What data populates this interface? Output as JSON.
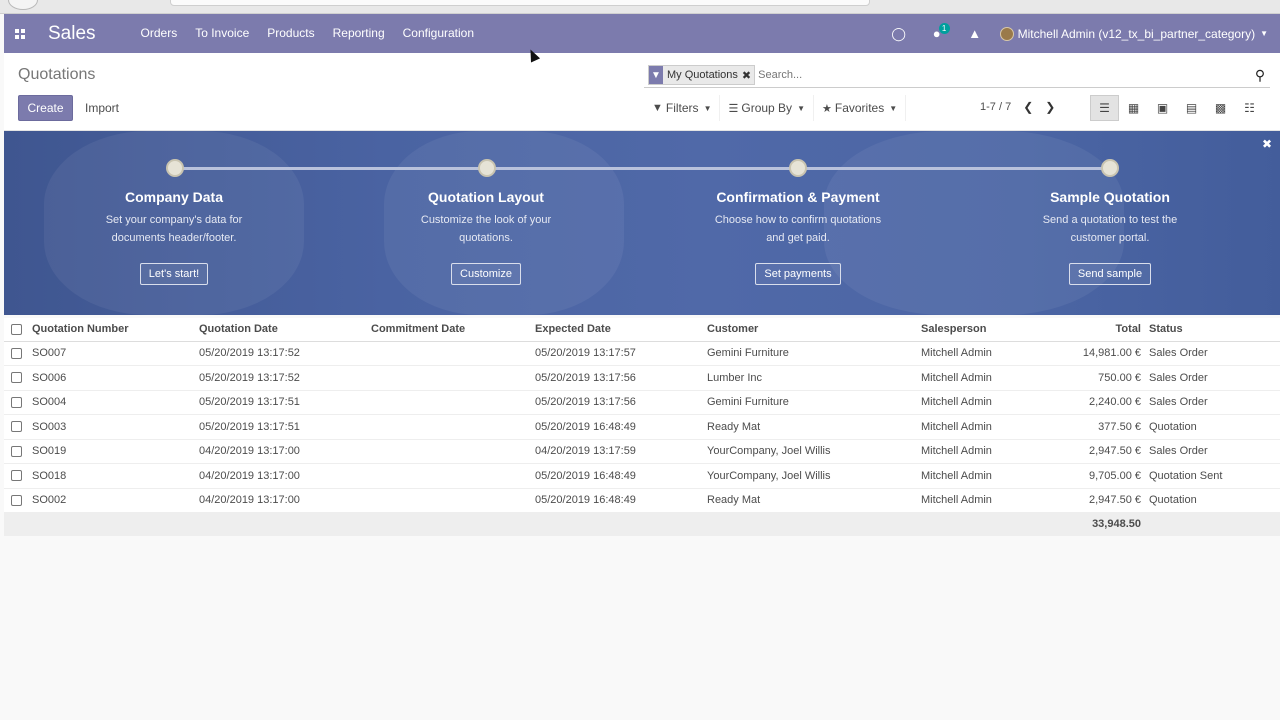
{
  "navbar": {
    "brand": "Sales",
    "menu": [
      "Orders",
      "To Invoice",
      "Products",
      "Reporting",
      "Configuration"
    ],
    "chat_count": "1",
    "user": "Mitchell Admin (v12_tx_bi_partner_category)"
  },
  "control": {
    "title": "Quotations",
    "create_label": "Create",
    "import_label": "Import",
    "facet_label": "My Quotations",
    "search_placeholder": "Search...",
    "filters_label": "Filters",
    "groupby_label": "Group By",
    "favorites_label": "Favorites",
    "pager": "1-7 / 7"
  },
  "banner": {
    "steps": [
      {
        "title": "Company Data",
        "desc1": "Set your company's data for",
        "desc2": "documents header/footer.",
        "button": "Let's start!"
      },
      {
        "title": "Quotation Layout",
        "desc1": "Customize the look of your",
        "desc2": "quotations.",
        "button": "Customize"
      },
      {
        "title": "Confirmation & Payment",
        "desc1": "Choose how to confirm quotations",
        "desc2": "and get paid.",
        "button": "Set payments"
      },
      {
        "title": "Sample Quotation",
        "desc1": "Send a quotation to test the",
        "desc2": "customer portal.",
        "button": "Send sample"
      }
    ]
  },
  "table": {
    "columns": [
      "Quotation Number",
      "Quotation Date",
      "Commitment Date",
      "Expected Date",
      "Customer",
      "Salesperson",
      "Total",
      "Status"
    ],
    "rows": [
      [
        "SO007",
        "05/20/2019 13:17:52",
        "",
        "05/20/2019 13:17:57",
        "Gemini Furniture",
        "Mitchell Admin",
        "14,981.00 €",
        "Sales Order"
      ],
      [
        "SO006",
        "05/20/2019 13:17:52",
        "",
        "05/20/2019 13:17:56",
        "Lumber Inc",
        "Mitchell Admin",
        "750.00 €",
        "Sales Order"
      ],
      [
        "SO004",
        "05/20/2019 13:17:51",
        "",
        "05/20/2019 13:17:56",
        "Gemini Furniture",
        "Mitchell Admin",
        "2,240.00 €",
        "Sales Order"
      ],
      [
        "SO003",
        "05/20/2019 13:17:51",
        "",
        "05/20/2019 16:48:49",
        "Ready Mat",
        "Mitchell Admin",
        "377.50 €",
        "Quotation"
      ],
      [
        "SO019",
        "04/20/2019 13:17:00",
        "",
        "04/20/2019 13:17:59",
        "YourCompany, Joel Willis",
        "Mitchell Admin",
        "2,947.50 €",
        "Sales Order"
      ],
      [
        "SO018",
        "04/20/2019 13:17:00",
        "",
        "05/20/2019 16:48:49",
        "YourCompany, Joel Willis",
        "Mitchell Admin",
        "9,705.00 €",
        "Quotation Sent"
      ],
      [
        "SO002",
        "04/20/2019 13:17:00",
        "",
        "05/20/2019 16:48:49",
        "Ready Mat",
        "Mitchell Admin",
        "2,947.50 €",
        "Quotation"
      ]
    ],
    "total": "33,948.50"
  },
  "colors": {
    "brand": "#7c7bad",
    "banner": "#4a63a2",
    "teal_badge": "#00a09d"
  }
}
